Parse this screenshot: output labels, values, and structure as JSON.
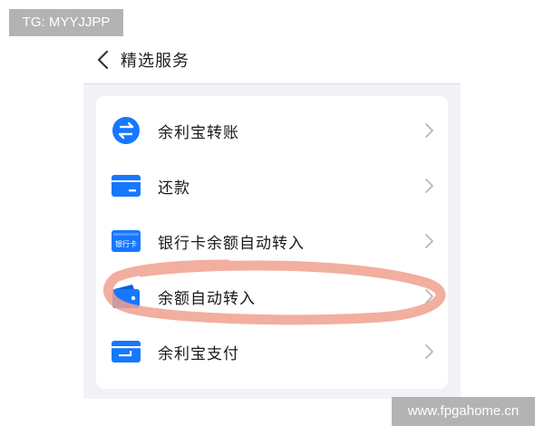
{
  "watermarks": {
    "top": "TG: MYYJJPP",
    "bottom": "www.fpgahome.cn"
  },
  "header": {
    "title": "精选服务",
    "back_icon": "chevron-left-icon"
  },
  "services": [
    {
      "label": "余利宝转账",
      "icon": "transfer-arrows-icon"
    },
    {
      "label": "还款",
      "icon": "credit-card-icon"
    },
    {
      "label": "银行卡余额自动转入",
      "icon": "bank-card-icon",
      "icon_text": "银行卡"
    },
    {
      "label": "余额自动转入",
      "icon": "wallet-icon"
    },
    {
      "label": "余利宝支付",
      "icon": "payment-card-icon"
    }
  ],
  "colors": {
    "accent": "#1677ff",
    "background": "#f2f3f7",
    "highlight_scribble": "#f0a08e"
  }
}
